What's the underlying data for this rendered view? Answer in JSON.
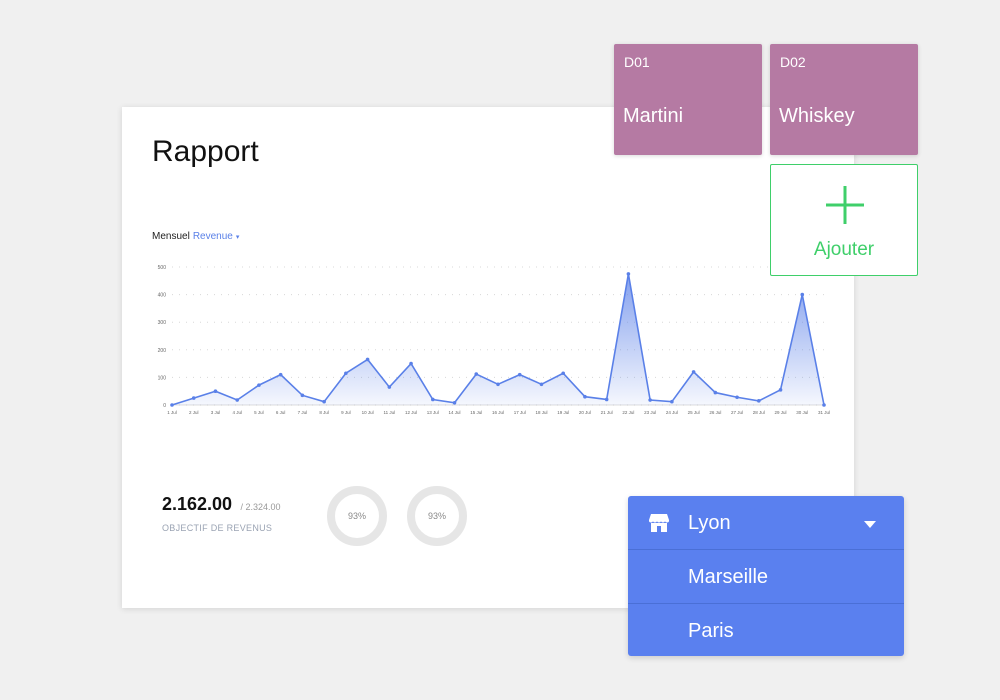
{
  "report": {
    "title": "Rapport",
    "period_label": "Mensuel",
    "metric_label": "Revenue",
    "caret": "▾"
  },
  "chart_data": {
    "type": "area",
    "title": "",
    "xlabel": "",
    "ylabel": "",
    "ylim": [
      0,
      500
    ],
    "yticks": [
      0,
      100,
      200,
      300,
      400,
      500
    ],
    "grid": true,
    "color": "#5a80e8",
    "categories": [
      "1 Jul",
      "2 Jul",
      "3 Jul",
      "4 Jul",
      "5 Jul",
      "6 Jul",
      "7 Jul",
      "8 Jul",
      "9 Jul",
      "10 Jul",
      "11 Jul",
      "12 Jul",
      "13 Jul",
      "14 Jul",
      "15 Jul",
      "16 Jul",
      "17 Jul",
      "18 Jul",
      "19 Jul",
      "20 Jul",
      "21 Jul",
      "22 Jul",
      "23 Jul",
      "24 Jul",
      "25 Jul",
      "26 Jul",
      "27 Jul",
      "28 Jul",
      "29 Jul",
      "30 Jul",
      "31 Jul"
    ],
    "values": [
      0,
      25,
      50,
      18,
      72,
      110,
      35,
      12,
      115,
      165,
      65,
      150,
      20,
      8,
      112,
      75,
      110,
      75,
      115,
      30,
      20,
      475,
      18,
      12,
      120,
      45,
      28,
      15,
      55,
      400,
      0
    ]
  },
  "summary": {
    "value": "2.162.00",
    "total": "/ 2.324.00",
    "label": "OBJECTIF DE REVENUS",
    "ring1_text": "93%",
    "ring2_text": "93%",
    "ring1_percent": 93,
    "ring2_percent": 93
  },
  "tiles": [
    {
      "code": "D01",
      "name": "Martini"
    },
    {
      "code": "D02",
      "name": "Whiskey"
    }
  ],
  "add": {
    "label": "Ajouter"
  },
  "location": {
    "selected": "Lyon",
    "options": [
      "Marseille",
      "Paris"
    ]
  },
  "colors": {
    "tile": "#b57aa3",
    "add_accent": "#3fcf6a",
    "dropdown": "#5a80ef",
    "chart_line": "#5a80e8"
  }
}
